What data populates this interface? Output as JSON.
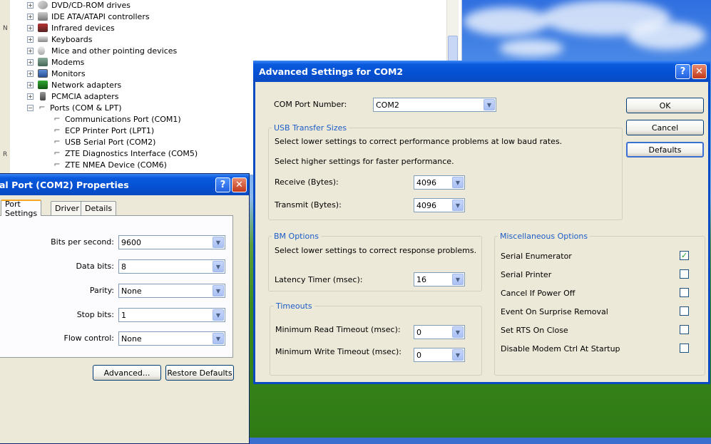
{
  "device_tree": {
    "items": [
      {
        "label": "DVD/CD-ROM drives",
        "expander": "+",
        "icon": "dvd-drive-icon"
      },
      {
        "label": "IDE ATA/ATAPI controllers",
        "expander": "+",
        "icon": "ide-controller-icon"
      },
      {
        "label": "Infrared devices",
        "expander": "+",
        "icon": "infrared-icon"
      },
      {
        "label": "Keyboards",
        "expander": "+",
        "icon": "keyboard-icon"
      },
      {
        "label": "Mice and other pointing devices",
        "expander": "+",
        "icon": "mouse-icon"
      },
      {
        "label": "Modems",
        "expander": "+",
        "icon": "modem-icon"
      },
      {
        "label": "Monitors",
        "expander": "+",
        "icon": "monitor-icon"
      },
      {
        "label": "Network adapters",
        "expander": "+",
        "icon": "network-adapter-icon"
      },
      {
        "label": "PCMCIA adapters",
        "expander": "+",
        "icon": "pcmcia-icon"
      },
      {
        "label": "Ports (COM & LPT)",
        "expander": "−",
        "icon": "port-icon"
      }
    ],
    "ports": [
      "Communications Port (COM1)",
      "ECP Printer Port (LPT1)",
      "USB Serial Port (COM2)",
      "ZTE Diagnostics Interface (COM5)",
      "ZTE NMEA Device (COM6)"
    ],
    "left_strip": [
      "N",
      "R"
    ]
  },
  "properties": {
    "title": "al Port (COM2) Properties",
    "help_glyph": "?",
    "close_glyph": "✕",
    "tabs": [
      "Port Settings",
      "Driver",
      "Details"
    ],
    "fields": [
      {
        "label": "Bits per second:",
        "value": "9600"
      },
      {
        "label": "Data bits:",
        "value": "8"
      },
      {
        "label": "Parity:",
        "value": "None"
      },
      {
        "label": "Stop bits:",
        "value": "1"
      },
      {
        "label": "Flow control:",
        "value": "None"
      }
    ],
    "advanced_button": "Advanced...",
    "restore_button": "Restore Defaults"
  },
  "advanced": {
    "title": "Advanced Settings for COM2",
    "help_glyph": "?",
    "close_glyph": "✕",
    "com_port_label": "COM Port Number:",
    "com_port_value": "COM2",
    "ok": "OK",
    "cancel": "Cancel",
    "defaults": "Defaults",
    "usb": {
      "title": "USB Transfer Sizes",
      "line1": "Select lower settings to correct performance problems at low baud rates.",
      "line2": "Select higher settings for faster performance.",
      "receive_label": "Receive (Bytes):",
      "receive_value": "4096",
      "transmit_label": "Transmit (Bytes):",
      "transmit_value": "4096"
    },
    "bm": {
      "title": "BM Options",
      "line1": "Select lower settings to correct response problems.",
      "latency_label": "Latency Timer (msec):",
      "latency_value": "16"
    },
    "timeouts": {
      "title": "Timeouts",
      "read_label": "Minimum Read Timeout (msec):",
      "read_value": "0",
      "write_label": "Minimum Write Timeout (msec):",
      "write_value": "0"
    },
    "misc": {
      "title": "Miscellaneous Options",
      "options": [
        {
          "label": "Serial Enumerator",
          "checked": true
        },
        {
          "label": "Serial Printer",
          "checked": false
        },
        {
          "label": "Cancel If Power Off",
          "checked": false
        },
        {
          "label": "Event On Surprise Removal",
          "checked": false
        },
        {
          "label": "Set RTS On Close",
          "checked": false
        },
        {
          "label": "Disable Modem Ctrl At Startup",
          "checked": false
        }
      ]
    }
  },
  "colors": {
    "titlebar": "#0450d2",
    "dialog_bg": "#ece9d8",
    "group_title": "#1c5cc7",
    "check_mark": "#21a121"
  }
}
